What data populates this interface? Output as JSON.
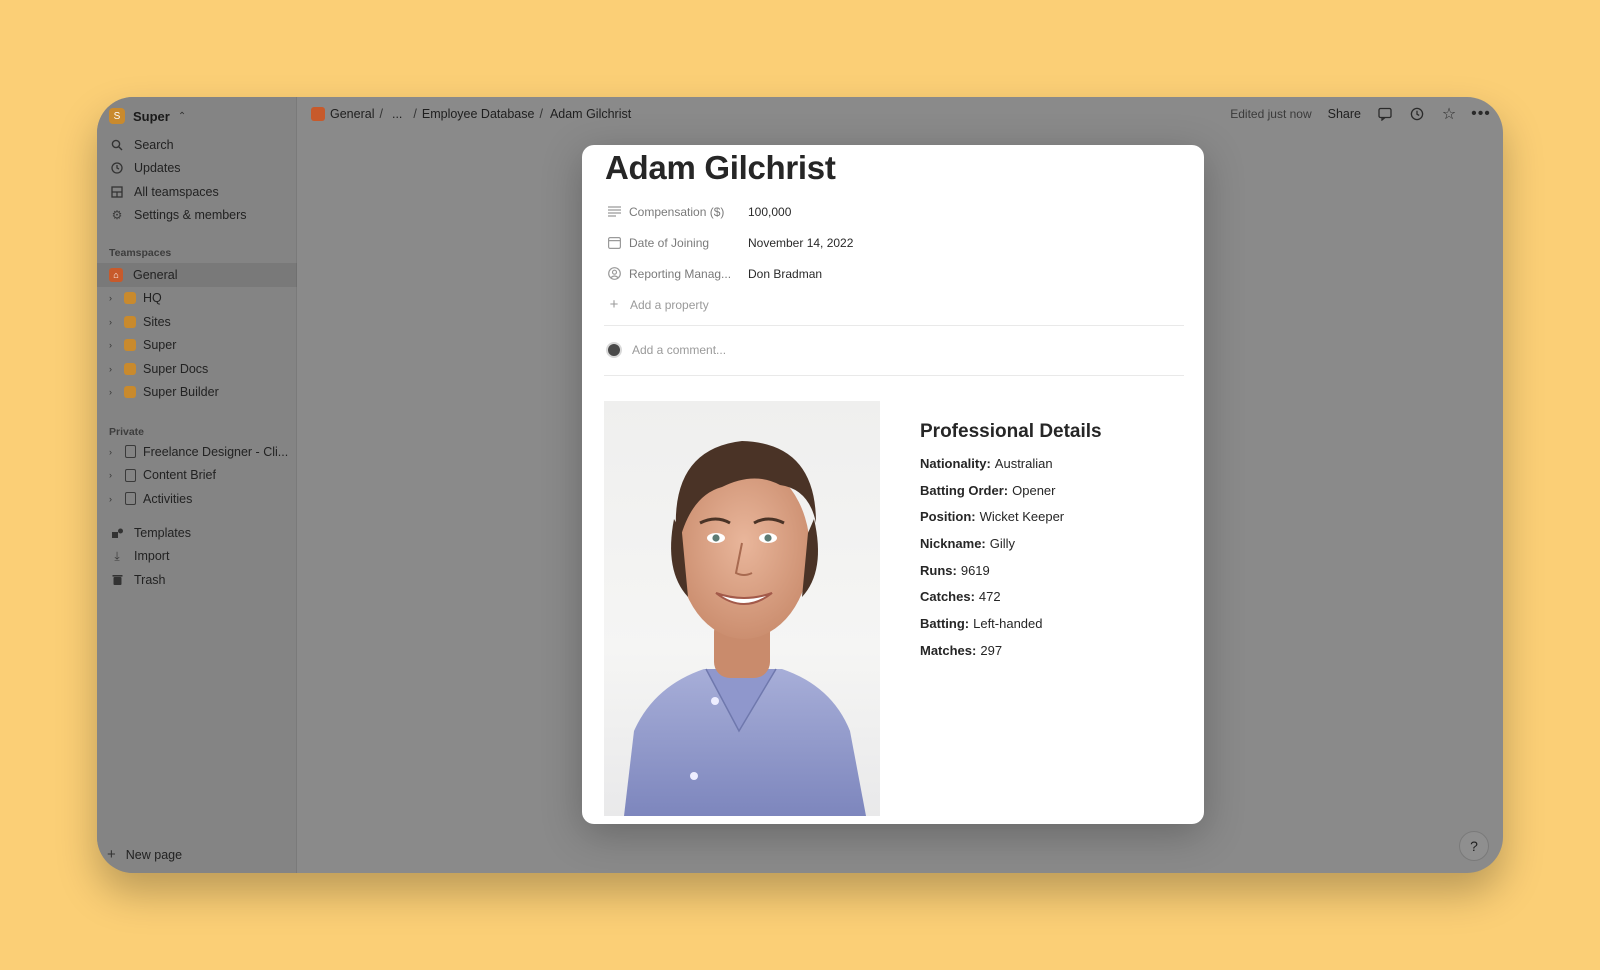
{
  "workspace": {
    "name": "Super",
    "logo_letter": "S"
  },
  "sidebar": {
    "nav": [
      {
        "label": "Search",
        "icon": "search-icon"
      },
      {
        "label": "Updates",
        "icon": "clock-icon"
      },
      {
        "label": "All teamspaces",
        "icon": "grid-icon"
      },
      {
        "label": "Settings & members",
        "icon": "gear-icon"
      }
    ],
    "teamspaces_label": "Teamspaces",
    "teamspaces": [
      {
        "label": "General"
      },
      {
        "label": "HQ"
      },
      {
        "label": "Sites"
      },
      {
        "label": "Super"
      },
      {
        "label": "Super Docs"
      },
      {
        "label": "Super Builder"
      }
    ],
    "private_label": "Private",
    "private": [
      {
        "label": "Freelance Designer - Cli..."
      },
      {
        "label": "Content Brief"
      },
      {
        "label": "Activities"
      }
    ],
    "bottom": [
      {
        "label": "Templates"
      },
      {
        "label": "Import"
      },
      {
        "label": "Trash"
      }
    ],
    "new_page": "New page"
  },
  "topbar": {
    "crumbs": [
      "General",
      "...",
      "Employee Database",
      "Adam Gilchrist"
    ],
    "edited": "Edited just now",
    "share": "Share"
  },
  "page": {
    "title": "Adam Gilchrist",
    "properties": [
      {
        "name": "Compensation ($)",
        "value": "100,000"
      },
      {
        "name": "Date of Joining",
        "value": "November 14, 2022"
      },
      {
        "name": "Reporting Manag...",
        "value": "Don Bradman"
      }
    ],
    "add_property": "Add a property",
    "comment_placeholder": "Add a comment...",
    "details_heading": "Professional Details",
    "details": [
      {
        "key": "Nationality:",
        "value": "Australian"
      },
      {
        "key": "Batting Order:",
        "value": "Opener"
      },
      {
        "key": "Position:",
        "value": "Wicket Keeper"
      },
      {
        "key": "Nickname:",
        "value": "Gilly"
      },
      {
        "key": "Runs:",
        "value": "9619"
      },
      {
        "key": "Catches:",
        "value": "472"
      },
      {
        "key": "Batting:",
        "value": "Left-handed"
      },
      {
        "key": "Matches:",
        "value": "297"
      }
    ]
  },
  "help": "?"
}
